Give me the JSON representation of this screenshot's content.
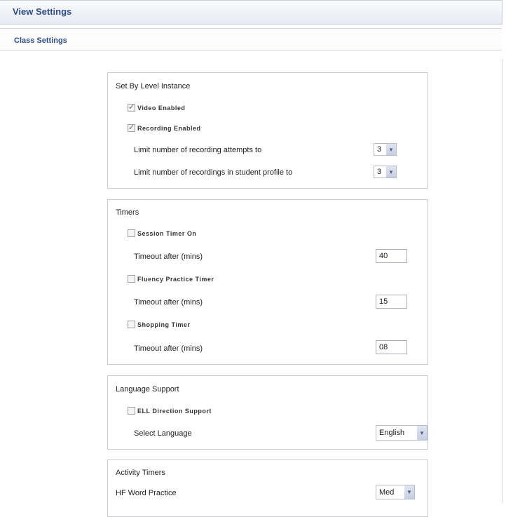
{
  "header": {
    "title": "View Settings"
  },
  "subheader": {
    "title": "Class Settings"
  },
  "level_panel": {
    "title": "Set By Level Instance",
    "video_enabled": {
      "label": "Video Enabled",
      "checked": true
    },
    "recording_enabled": {
      "label": "Recording Enabled",
      "checked": true
    },
    "attempts_label": "Limit number of recording attempts to",
    "attempts_value": "3",
    "profile_label": "Limit number of recordings in student profile to",
    "profile_value": "3"
  },
  "timers_panel": {
    "title": "Timers",
    "session": {
      "label": "Session Timer On",
      "checked": false,
      "timeout_label": "Timeout after (mins)",
      "value": "40"
    },
    "fluency": {
      "label": "Fluency Practice Timer",
      "checked": false,
      "timeout_label": "Timeout after (mins)",
      "value": "15"
    },
    "shopping": {
      "label": "Shopping Timer",
      "checked": false,
      "timeout_label": "Timeout after (mins)",
      "value": "08"
    }
  },
  "language_panel": {
    "title": "Language Support",
    "ell": {
      "label": "ELL Direction Support",
      "checked": false
    },
    "select_label": "Select Language",
    "language_value": "English"
  },
  "activity_panel": {
    "title": "Activity Timers",
    "hf_label": "HF Word Practice",
    "hf_value": "Med"
  },
  "icons": {
    "dropdown": "chevron-down-icon",
    "checkbox_check": "check-icon"
  }
}
